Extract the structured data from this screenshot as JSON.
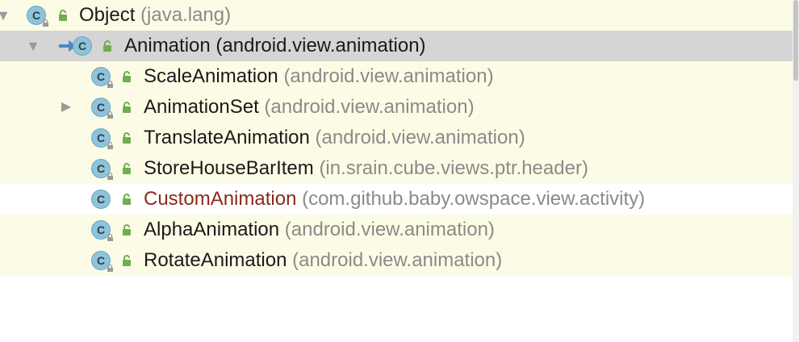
{
  "tree": {
    "root": {
      "name": "Object",
      "package": "(java.lang)"
    },
    "selected": {
      "name": "Animation",
      "package": "(android.view.animation)"
    },
    "children": [
      {
        "name": "ScaleAnimation",
        "package": "(android.view.animation)"
      },
      {
        "name": "AnimationSet",
        "package": "(android.view.animation)"
      },
      {
        "name": "TranslateAnimation",
        "package": "(android.view.animation)"
      },
      {
        "name": "StoreHouseBarItem",
        "package": "(in.srain.cube.views.ptr.header)"
      },
      {
        "name": "CustomAnimation",
        "package": "(com.github.baby.owspace.view.activity)"
      },
      {
        "name": "AlphaAnimation",
        "package": "(android.view.animation)"
      },
      {
        "name": "RotateAnimation",
        "package": "(android.view.animation)"
      }
    ]
  },
  "icons": {
    "class_letter": "C",
    "expand": "triangle-down",
    "collapse": "triangle-right",
    "visibility": "public-lock-icon",
    "implementation": "implementation-arrow-icon"
  },
  "colors": {
    "library_row_bg": "#fcfce6",
    "selected_row_bg": "#d5d5d5",
    "package_text": "#8a8a8a",
    "custom_class_text": "#8b2a1a",
    "class_icon_bg": "#8fc3d9",
    "visibility_icon": "#6fae4f",
    "implementation_arrow": "#4a86c8"
  }
}
